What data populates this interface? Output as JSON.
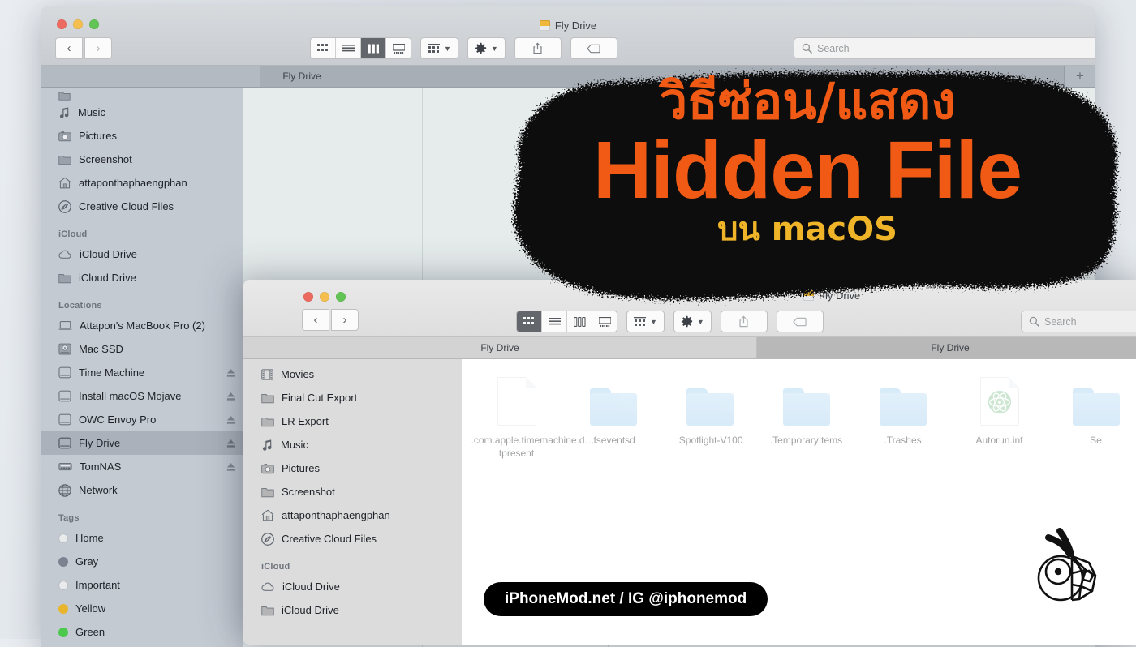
{
  "desktop": {
    "background": "#e6eaee"
  },
  "overlay": {
    "thai_headline": "วิธีซ่อน/แสดง",
    "english_headline": "Hidden File",
    "thai_subline": "บน macOS",
    "headline_color": "#f05a14",
    "subline_color": "#f0b429",
    "watermark": "iPhoneMod.net / IG @iphonemod"
  },
  "back_window": {
    "title": "Fly Drive",
    "view_mode": "column",
    "search": {
      "placeholder": "Search",
      "value": ""
    },
    "nav": {
      "back": "‹",
      "forward": "›"
    },
    "tabs": [
      {
        "label": "Fly Drive",
        "active": true
      },
      {
        "label": "",
        "active": false
      }
    ],
    "new_tab_label": "+",
    "view_buttons": [
      "icon-view",
      "list-view",
      "column-view",
      "gallery-view"
    ],
    "toolbar_buttons": [
      "group-by",
      "action-gear",
      "share",
      "tags"
    ],
    "sidebar": [
      {
        "label": "Music",
        "icon": "music-note-icon",
        "group": ""
      },
      {
        "label": "Pictures",
        "icon": "camera-icon",
        "group": ""
      },
      {
        "label": "Screenshot",
        "icon": "folder-icon",
        "group": ""
      },
      {
        "label": "attaponthaphaengphan",
        "icon": "home-icon",
        "group": ""
      },
      {
        "label": "Creative Cloud Files",
        "icon": "creative-cloud-icon",
        "group": ""
      },
      {
        "label": "iCloud Drive",
        "icon": "cloud-icon",
        "group": "iCloud"
      },
      {
        "label": "iCloud Drive",
        "icon": "folder-icon",
        "group": "iCloud"
      },
      {
        "label": "Attapon's MacBook Pro (2)",
        "icon": "laptop-icon",
        "group": "Locations"
      },
      {
        "label": "Mac SSD",
        "icon": "internal-disk-icon",
        "group": "Locations"
      },
      {
        "label": "Time Machine",
        "icon": "external-disk-icon",
        "group": "Locations",
        "eject": true
      },
      {
        "label": "Install macOS Mojave",
        "icon": "external-disk-icon",
        "group": "Locations",
        "eject": true
      },
      {
        "label": "OWC Envoy Pro",
        "icon": "external-disk-icon",
        "group": "Locations",
        "eject": true
      },
      {
        "label": "Fly Drive",
        "icon": "external-disk-icon",
        "group": "Locations",
        "eject": true,
        "selected": true
      },
      {
        "label": "TomNAS",
        "icon": "nas-icon",
        "group": "Locations",
        "eject": true
      },
      {
        "label": "Network",
        "icon": "globe-icon",
        "group": "Locations"
      },
      {
        "label": "Home",
        "icon": "tag-dot",
        "group": "Tags",
        "color": "#e8eaec"
      },
      {
        "label": "Gray",
        "icon": "tag-dot",
        "group": "Tags",
        "color": "#7b8290"
      },
      {
        "label": "Important",
        "icon": "tag-dot",
        "group": "Tags",
        "color": "#e8eaec"
      },
      {
        "label": "Yellow",
        "icon": "tag-dot",
        "group": "Tags",
        "color": "#e8b52f"
      },
      {
        "label": "Green",
        "icon": "tag-dot",
        "group": "Tags",
        "color": "#4cc94c"
      }
    ],
    "group_headers": [
      "iCloud",
      "Locations",
      "Tags"
    ]
  },
  "front_window": {
    "title": "Fly Drive",
    "view_mode": "icon",
    "search": {
      "placeholder": "Search",
      "value": ""
    },
    "nav": {
      "back": "‹",
      "forward": "›"
    },
    "tabs": [
      {
        "label": "Fly Drive",
        "active": false
      },
      {
        "label": "Fly Drive",
        "active": true
      }
    ],
    "view_buttons": [
      "icon-view",
      "list-view",
      "column-view",
      "gallery-view"
    ],
    "toolbar_buttons": [
      "group-by",
      "action-gear",
      "share",
      "tags"
    ],
    "sidebar": [
      {
        "label": "Movies",
        "icon": "film-icon",
        "group": ""
      },
      {
        "label": "Final Cut Export",
        "icon": "folder-icon",
        "group": ""
      },
      {
        "label": "LR Export",
        "icon": "folder-icon",
        "group": ""
      },
      {
        "label": "Music",
        "icon": "music-note-icon",
        "group": ""
      },
      {
        "label": "Pictures",
        "icon": "camera-icon",
        "group": ""
      },
      {
        "label": "Screenshot",
        "icon": "folder-icon",
        "group": ""
      },
      {
        "label": "attaponthaphaengphan",
        "icon": "home-icon",
        "group": ""
      },
      {
        "label": "Creative Cloud Files",
        "icon": "creative-cloud-icon",
        "group": ""
      },
      {
        "label": "iCloud Drive",
        "icon": "cloud-icon",
        "group": "iCloud"
      },
      {
        "label": "iCloud Drive",
        "icon": "folder-icon",
        "group": "iCloud"
      }
    ],
    "group_headers": [
      "iCloud"
    ],
    "files": [
      {
        "name": ".com.apple.timemachine.d…tpresent",
        "type": "document"
      },
      {
        "name": ".fseventsd",
        "type": "folder"
      },
      {
        "name": ".Spotlight-V100",
        "type": "folder"
      },
      {
        "name": ".TemporaryItems",
        "type": "folder"
      },
      {
        "name": ".Trashes",
        "type": "folder"
      },
      {
        "name": "Autorun.inf",
        "type": "document-atom"
      },
      {
        "name": "Se",
        "type": "folder"
      }
    ]
  }
}
